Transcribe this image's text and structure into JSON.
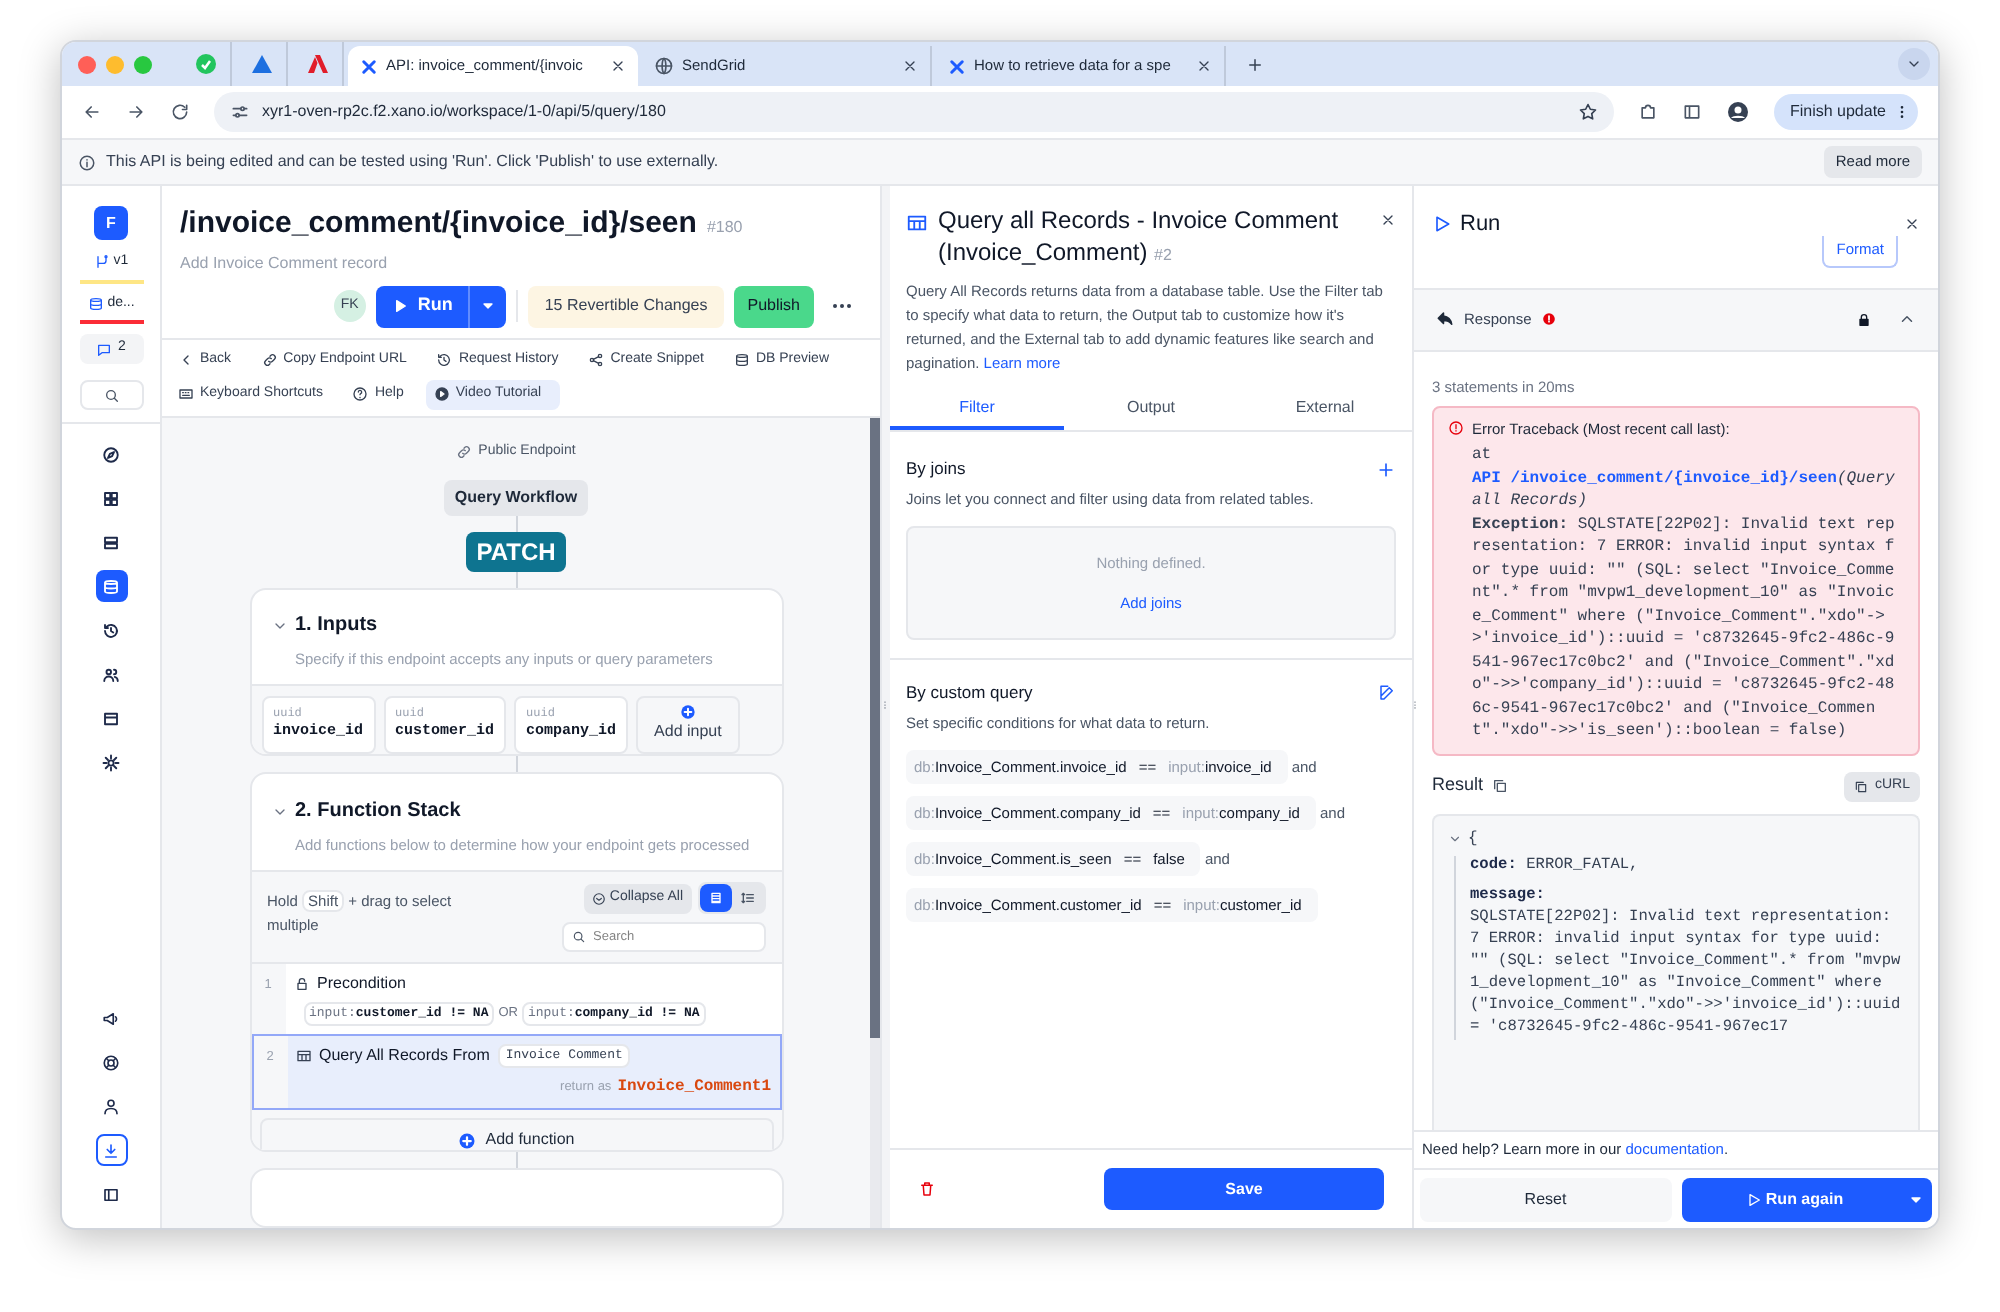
{
  "browser": {
    "tabs": [
      {
        "title": "API: invoice_comment/{invoic",
        "selected": true
      },
      {
        "title": "SendGrid",
        "selected": false
      },
      {
        "title": "How to retrieve data for a spe",
        "selected": false
      }
    ],
    "url": "xyr1-oven-rp2c.f2.xano.io/workspace/1-0/api/5/query/180",
    "update_button": "Finish update"
  },
  "notice": {
    "message": "This API is being edited and can be tested using 'Run'. Click 'Publish' to use externally.",
    "action": "Read more"
  },
  "sidebar": {
    "workspace": "F",
    "branch": "v1",
    "datasource": "de...",
    "comments": "2",
    "nav": [
      {
        "kind": "compass",
        "selected": false
      },
      {
        "kind": "grid",
        "selected": false
      },
      {
        "kind": "server",
        "selected": false
      },
      {
        "kind": "database",
        "selected": true
      },
      {
        "kind": "history",
        "selected": false
      },
      {
        "kind": "users",
        "selected": false
      },
      {
        "kind": "storage",
        "selected": false
      },
      {
        "kind": "gear",
        "selected": false
      }
    ],
    "bottom": [
      {
        "kind": "megaphone",
        "highlighted": false
      },
      {
        "kind": "lifebuoy",
        "highlighted": false
      },
      {
        "kind": "user",
        "highlighted": false
      },
      {
        "kind": "download",
        "highlighted": true
      },
      {
        "kind": "panel",
        "highlighted": false
      }
    ]
  },
  "endpoint": {
    "title": "/invoice_comment/{invoice_id}/seen",
    "number": "#180",
    "description": "Add Invoice Comment record",
    "avatar": "FK",
    "run": "Run",
    "changes": "15 Revertible Changes",
    "publish": "Publish",
    "toolbar": [
      {
        "kind": "back",
        "label": "Back",
        "selected": false
      },
      {
        "kind": "link",
        "label": "Copy Endpoint URL",
        "selected": false
      },
      {
        "kind": "history",
        "label": "Request History",
        "selected": false
      },
      {
        "kind": "share",
        "label": "Create Snippet",
        "selected": false
      },
      {
        "kind": "database",
        "label": "DB Preview",
        "selected": false
      },
      {
        "kind": "keyboard",
        "label": "Keyboard Shortcuts",
        "selected": false
      },
      {
        "kind": "help",
        "label": "Help",
        "selected": false
      },
      {
        "kind": "video",
        "label": "Video Tutorial",
        "selected": true
      }
    ]
  },
  "canvas": {
    "access": "Public Endpoint",
    "workflow": "Query Workflow",
    "method": "PATCH",
    "inputs": {
      "title": "1. Inputs",
      "description": "Specify if this endpoint accepts any inputs or query parameters",
      "fields": [
        {
          "type": "uuid",
          "name": "invoice_id"
        },
        {
          "type": "uuid",
          "name": "customer_id"
        },
        {
          "type": "uuid",
          "name": "company_id"
        }
      ],
      "add": "Add input"
    },
    "function_stack": {
      "title": "2. Function Stack",
      "description": "Add functions below to determine how your endpoint gets processed",
      "hint_start": "Hold",
      "hint_key": "Shift",
      "hint_end": "+ drag to select multiple",
      "collapse": "Collapse All",
      "views": [
        {
          "kind": "list",
          "selected": true
        },
        {
          "kind": "sort",
          "selected": false
        }
      ],
      "search_placeholder": "Search",
      "steps": [
        {
          "number": "1",
          "kind": "precondition",
          "title": "Precondition",
          "selected": false,
          "conditions": [
            {
              "prefix": "input:",
              "expression": "customer_id != NA"
            },
            {
              "prefix": "input:",
              "expression": "company_id != NA"
            }
          ],
          "joiner": "OR"
        },
        {
          "number": "2",
          "kind": "query",
          "title": "Query All Records From",
          "table": "Invoice Comment",
          "return_label": "return as",
          "return_var": "Invoice_Comment1",
          "selected": true
        }
      ],
      "add": "Add function"
    }
  },
  "query_panel": {
    "title": "Query all Records - Invoice Comment (Invoice_Comment)",
    "number": "#2",
    "description": "Query All Records returns data from a database table. Use the Filter tab to specify what data to return, the Output tab to customize how it's returned, and the External tab to add dynamic features like search and pagination.",
    "learn_more": "Learn more",
    "tabs": [
      {
        "label": "Filter",
        "selected": true
      },
      {
        "label": "Output",
        "selected": false
      },
      {
        "label": "External",
        "selected": false
      }
    ],
    "joins": {
      "title": "By joins",
      "description": "Joins let you connect and filter using data from related tables.",
      "empty": "Nothing defined.",
      "add": "Add joins"
    },
    "custom_query": {
      "title": "By custom query",
      "description": "Set specific conditions for what data to return.",
      "conditions": [
        {
          "left_prefix": "db:",
          "left": "Invoice_Comment.invoice_id",
          "operator": "==",
          "right_prefix": "input:",
          "right": "invoice_id",
          "joiner": "and"
        },
        {
          "left_prefix": "db:",
          "left": "Invoice_Comment.company_id",
          "operator": "==",
          "right_prefix": "input:",
          "right": "company_id",
          "joiner": "and"
        },
        {
          "left_prefix": "db:",
          "left": "Invoice_Comment.is_seen",
          "operator": "==",
          "right": "false",
          "joiner": "and"
        },
        {
          "left_prefix": "db:",
          "left": "Invoice_Comment.customer_id",
          "operator": "==",
          "right_prefix": "input:",
          "right": "customer_id"
        }
      ]
    },
    "save": "Save"
  },
  "run_panel": {
    "title": "Run",
    "format": "Format",
    "response": "Response",
    "stats": "3 statements in 20ms",
    "error": {
      "title": "Error Traceback (Most recent call last):",
      "at": "at",
      "link": "API /invoice_comment/{invoice_id}/seen",
      "context": "(Query all Records)",
      "exception": "**Exception:** SQLSTATE[22P02]: Invalid text representation: 7 ERROR: invalid input syntax for type uuid: \"\" (SQL: select \"Invoice_Comment\".* from \"mvpw1_development_10\" as \"Invoice_Comment\" where (\"Invoice_Comment\".\"xdo\"->>'invoice_id')::uuid = 'c8732645-9fc2-486c-9541-967ec17c0bc2' and (\"Invoice_Comment\".\"xdo\"->>'company_id')::uuid = 'c8732645-9fc2-486c-9541-967ec17c0bc2' and (\"Invoice_Comment\".\"xdo\"->>'is_seen')::boolean = false)"
    },
    "result": {
      "title": "Result",
      "curl": "cURL",
      "open": "{",
      "code_key": "code:",
      "code_value": "ERROR_FATAL,",
      "message_key": "message:",
      "message_value": "SQLSTATE[22P02]: Invalid text representation: 7 ERROR: invalid input syntax for type uuid: \"\" (SQL: select \"Invoice_Comment\".* from \"mvpw1_development_10\" as \"Invoice_Comment\" where (\"Invoice_Comment\".\"xdo\"->>'invoice_id')::uuid = 'c8732645-9fc2-486c-9541-967ec17"
    },
    "help": {
      "text": "Need help? Learn more in our",
      "link": "documentation",
      "end": "."
    },
    "reset": "Reset",
    "run_again": "Run again"
  }
}
